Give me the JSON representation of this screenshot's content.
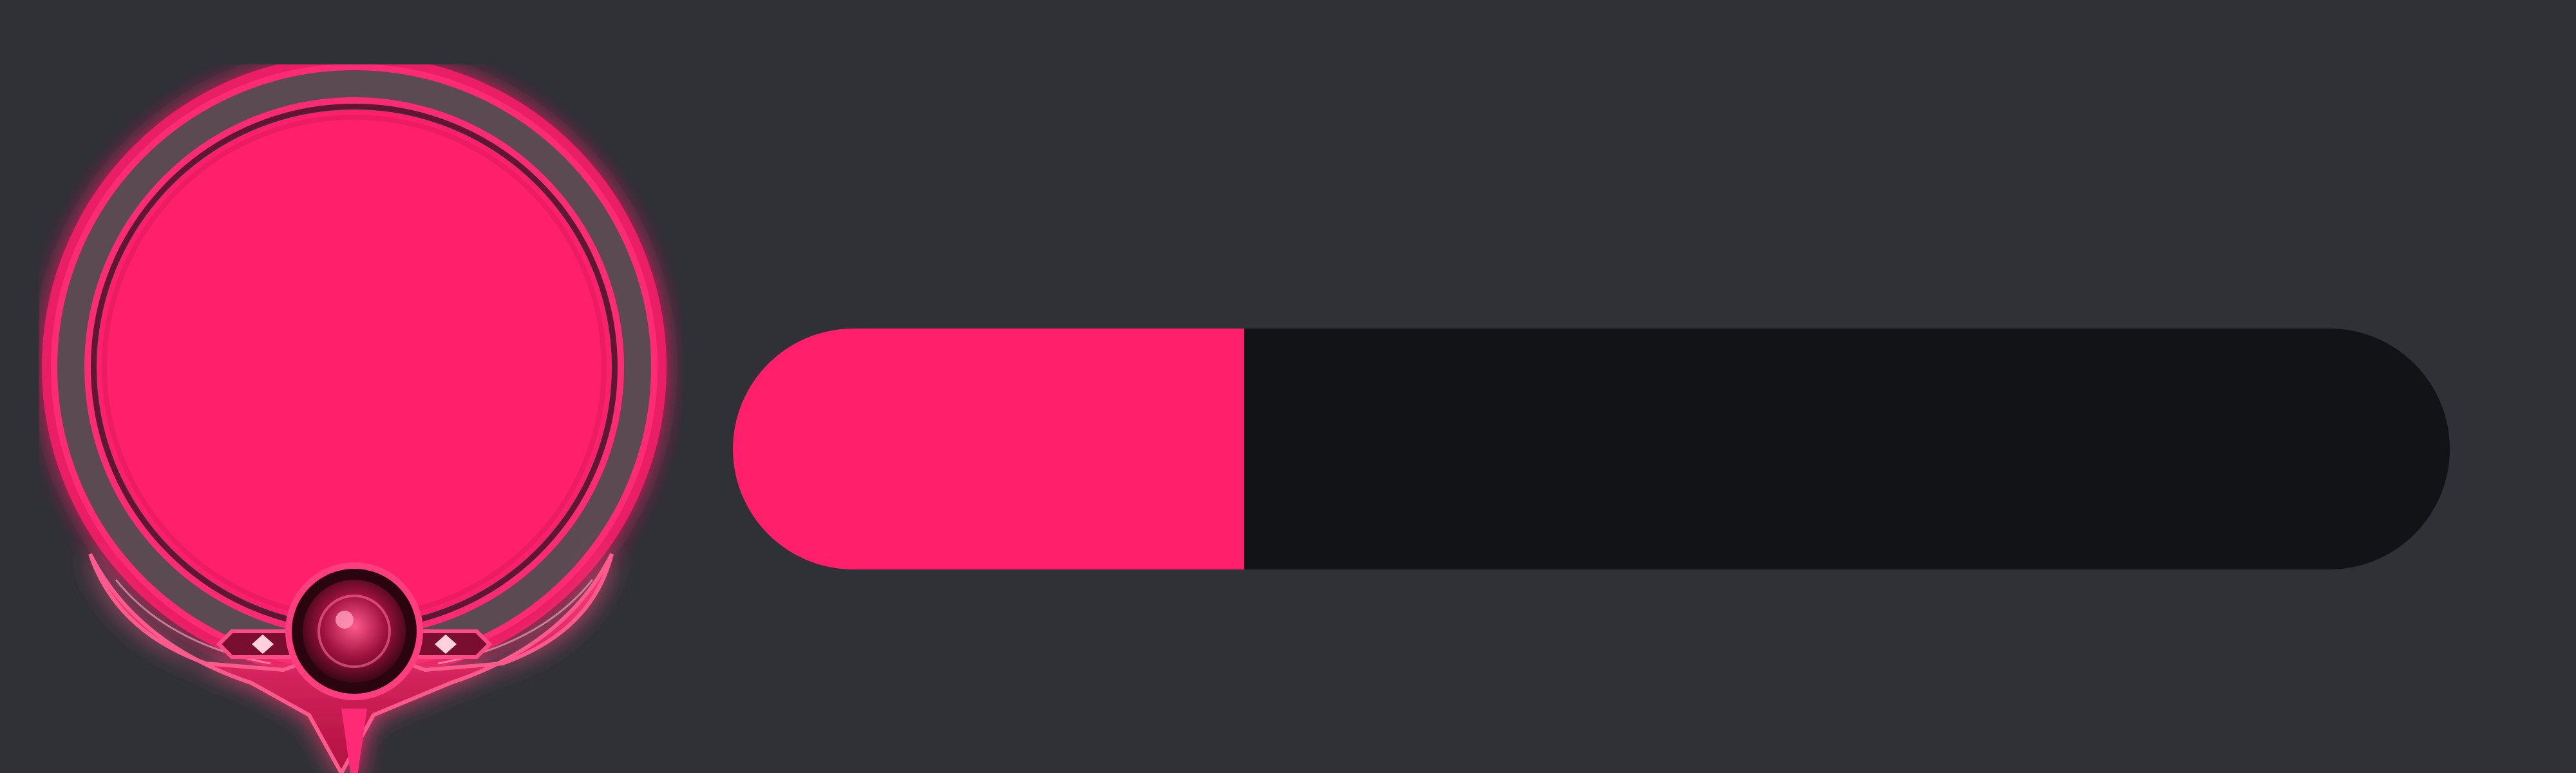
{
  "colors": {
    "background": "#2f3136",
    "accent": "#ff1f6b",
    "track": "#111316",
    "frame_ring": "#5c4a52",
    "frame_dark": "#3a1020"
  },
  "avatar": {
    "frame_icon": "ornate-avatar-frame-icon",
    "gem_icon": "gem-ornament-icon",
    "fill_color": "#ff1f6b"
  },
  "progress": {
    "fraction": 0.298
  }
}
